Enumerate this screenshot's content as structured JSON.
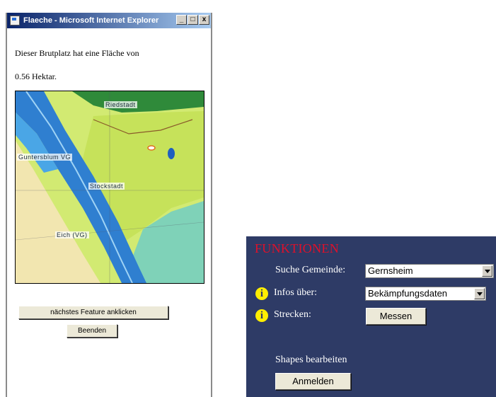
{
  "popup": {
    "title": "Flaeche - Microsoft Internet Explorer",
    "window_controls": {
      "minimize": "_",
      "maximize": "□",
      "close": "x"
    },
    "area_text_line1": "Dieser Brutplatz hat eine Fläche von",
    "area_text_line2": "0.56 Hektar.",
    "map_labels": [
      "Riedstadt",
      "Guntersblum VG",
      "Stockstadt",
      "Eich (VG)"
    ],
    "next_feature_label": "nächstes Feature anklicken",
    "close_label": "Beenden"
  },
  "panel": {
    "title": "FUNKTIONEN",
    "search_label": "Suche Gemeinde:",
    "search_value": "Gernsheim",
    "info_label": "Infos über:",
    "info_value": "Bekämpfungsdaten",
    "routes_label": "Strecken:",
    "measure_label": "Messen",
    "shapes_label": "Shapes bearbeiten",
    "login_label": "Anmelden",
    "info_icon_glyph": "i",
    "colors": {
      "background": "#2e3b66",
      "title": "#e0102a",
      "info_icon": "#ffee00"
    }
  }
}
